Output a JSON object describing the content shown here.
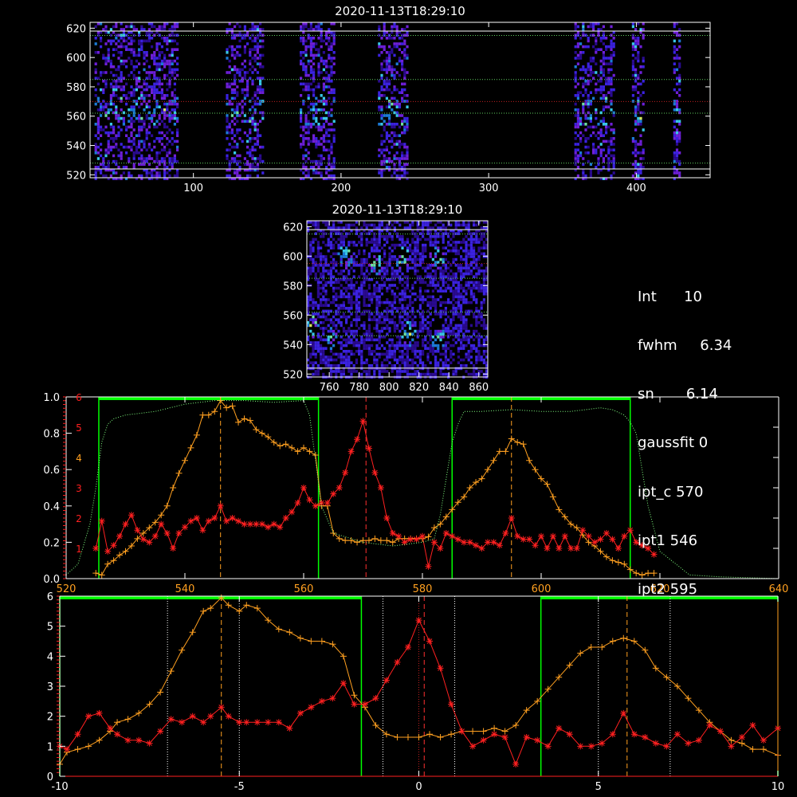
{
  "chart_data": [
    {
      "type": "heatmap",
      "title": "2020-11-13T18:29:10",
      "xticks": [
        100,
        200,
        300,
        400
      ],
      "yticks": [
        520,
        540,
        560,
        580,
        600,
        620
      ],
      "xlim": [
        30,
        450
      ],
      "ylim": [
        518,
        624
      ],
      "hlines": {
        "white": [
          524,
          618
        ],
        "green_dotted": [
          528,
          562,
          585,
          615
        ],
        "red_dotted": [
          570
        ]
      },
      "bands": [
        [
          33,
          90
        ],
        [
          122,
          147
        ],
        [
          172,
          195
        ],
        [
          225,
          245
        ],
        [
          358,
          385
        ],
        [
          397,
          405
        ],
        [
          425,
          429
        ]
      ],
      "colormap": [
        "#000000",
        "#2a0a8f",
        "#3b22e0",
        "#6e1fd8",
        "#1c7ad6",
        "#38c6e6",
        "#6ee0a0",
        "#d4e860"
      ]
    },
    {
      "type": "heatmap",
      "title": "2020-11-13T18:29:10",
      "xticks": [
        760,
        780,
        800,
        820,
        840,
        860
      ],
      "yticks": [
        520,
        540,
        560,
        580,
        600,
        620
      ],
      "xlim": [
        745,
        866
      ],
      "ylim": [
        518,
        624
      ],
      "hlines": {
        "white": [
          524,
          618
        ],
        "green_dotted": [
          546,
          562,
          585,
          615
        ],
        "red_dotted": [
          595
        ]
      },
      "hot_spots": [
        [
          831,
          600
        ],
        [
          832,
          545
        ],
        [
          812,
          548
        ],
        [
          808,
          600
        ],
        [
          760,
          545
        ],
        [
          748,
          553
        ],
        [
          770,
          600
        ],
        [
          790,
          595
        ]
      ]
    },
    {
      "type": "line",
      "xticks": [
        520,
        540,
        560,
        580,
        600,
        620,
        640
      ],
      "yticks_left": [
        0.0,
        0.2,
        0.4,
        0.6,
        0.8,
        1.0
      ],
      "ytick_labels_left": [
        "0.0",
        "0.2",
        "0.4",
        "0.6",
        "0.8",
        "1.0"
      ],
      "yticks_right": [
        1,
        2,
        3,
        4,
        5,
        6
      ],
      "xlim": [
        520,
        640
      ],
      "ylim": [
        0,
        1.0
      ],
      "ylim_right": [
        0,
        6
      ],
      "green_windows": [
        [
          525.5,
          562.5
        ],
        [
          585,
          615
        ]
      ],
      "orange_dashed_x": [
        546,
        595
      ],
      "red_dashed_x": [
        570.5
      ],
      "series": [
        {
          "color": "#ffa020",
          "marker": "+",
          "axis": "left",
          "x": [
            525,
            526,
            527,
            528,
            529,
            530,
            531,
            532,
            533,
            534,
            535,
            536,
            537,
            538,
            539,
            540,
            541,
            542,
            543,
            544,
            545,
            546,
            547,
            548,
            549,
            550,
            551,
            552,
            553,
            554,
            555,
            556,
            557,
            558,
            559,
            560,
            561,
            562,
            563,
            564,
            565,
            566,
            567,
            568,
            569,
            570,
            571,
            572,
            573,
            574,
            575,
            576,
            577,
            578,
            579,
            580,
            581,
            582,
            583,
            584,
            585,
            586,
            587,
            588,
            589,
            590,
            591,
            592,
            593,
            594,
            595,
            596,
            597,
            598,
            599,
            600,
            601,
            602,
            603,
            604,
            605,
            606,
            607,
            608,
            609,
            610,
            611,
            612,
            613,
            614,
            615,
            616,
            617,
            618,
            619
          ],
          "y": [
            0.03,
            0.02,
            0.08,
            0.1,
            0.13,
            0.15,
            0.18,
            0.22,
            0.25,
            0.28,
            0.31,
            0.35,
            0.4,
            0.5,
            0.58,
            0.65,
            0.72,
            0.79,
            0.9,
            0.9,
            0.92,
            0.98,
            0.94,
            0.95,
            0.86,
            0.88,
            0.87,
            0.82,
            0.8,
            0.78,
            0.75,
            0.73,
            0.74,
            0.72,
            0.7,
            0.72,
            0.7,
            0.68,
            0.4,
            0.4,
            0.25,
            0.22,
            0.21,
            0.21,
            0.2,
            0.21,
            0.21,
            0.22,
            0.21,
            0.21,
            0.2,
            0.22,
            0.22,
            0.22,
            0.22,
            0.22,
            0.23,
            0.28,
            0.3,
            0.34,
            0.38,
            0.42,
            0.45,
            0.5,
            0.53,
            0.55,
            0.6,
            0.65,
            0.7,
            0.7,
            0.77,
            0.75,
            0.74,
            0.65,
            0.6,
            0.55,
            0.52,
            0.45,
            0.38,
            0.34,
            0.3,
            0.28,
            0.24,
            0.2,
            0.18,
            0.15,
            0.12,
            0.1,
            0.09,
            0.08,
            0.05,
            0.03,
            0.02,
            0.03,
            0.03
          ]
        },
        {
          "color": "#ff2020",
          "marker": "*",
          "axis": "right",
          "x": [
            525,
            526,
            527,
            528,
            529,
            530,
            531,
            532,
            533,
            534,
            535,
            536,
            537,
            538,
            539,
            540,
            541,
            542,
            543,
            544,
            545,
            546,
            547,
            548,
            549,
            550,
            551,
            552,
            553,
            554,
            555,
            556,
            557,
            558,
            559,
            560,
            561,
            562,
            563,
            564,
            565,
            566,
            567,
            568,
            569,
            570,
            571,
            572,
            573,
            574,
            575,
            576,
            577,
            578,
            579,
            580,
            581,
            582,
            583,
            584,
            585,
            586,
            587,
            588,
            589,
            590,
            591,
            592,
            593,
            594,
            595,
            596,
            597,
            598,
            599,
            600,
            601,
            602,
            603,
            604,
            605,
            606,
            607,
            608,
            609,
            610,
            611,
            612,
            613,
            614,
            615,
            616,
            617,
            618,
            619
          ],
          "y": [
            1.0,
            1.9,
            0.9,
            1.1,
            1.4,
            1.8,
            2.1,
            1.6,
            1.3,
            1.2,
            1.4,
            1.8,
            1.5,
            1.0,
            1.5,
            1.7,
            1.9,
            2.0,
            1.6,
            1.9,
            2.0,
            2.4,
            1.9,
            2.0,
            1.9,
            1.8,
            1.8,
            1.8,
            1.8,
            1.7,
            1.8,
            1.7,
            2.0,
            2.2,
            2.5,
            3.0,
            2.6,
            2.4,
            2.5,
            2.5,
            2.8,
            3.0,
            3.5,
            4.2,
            4.6,
            5.2,
            4.3,
            3.5,
            3.0,
            2.0,
            1.5,
            1.4,
            1.2,
            1.3,
            1.3,
            1.4,
            0.4,
            1.2,
            1.0,
            1.5,
            1.4,
            1.3,
            1.2,
            1.2,
            1.1,
            1.0,
            1.2,
            1.2,
            1.1,
            1.5,
            2.0,
            1.4,
            1.3,
            1.3,
            1.1,
            1.4,
            1.0,
            1.4,
            1.0,
            1.4,
            1.0,
            1.0,
            1.6,
            1.4,
            1.2,
            1.3,
            1.5,
            1.3,
            1.0,
            1.4,
            1.6,
            1.2,
            1.1,
            1.0,
            0.8
          ]
        },
        {
          "color": "#80ff80",
          "style": "dotted",
          "axis": "left",
          "x": [
            520,
            522,
            524,
            525,
            526,
            527,
            528,
            530,
            535,
            540,
            545,
            550,
            555,
            560,
            561,
            562,
            563,
            565,
            570,
            575,
            580,
            582,
            583,
            584,
            585,
            586,
            587,
            590,
            595,
            600,
            605,
            610,
            612,
            614,
            615,
            616,
            617,
            618,
            620,
            625,
            630,
            640
          ],
          "y": [
            0.02,
            0.08,
            0.3,
            0.5,
            0.75,
            0.85,
            0.88,
            0.9,
            0.92,
            0.96,
            0.98,
            0.98,
            0.97,
            0.98,
            0.9,
            0.65,
            0.4,
            0.25,
            0.2,
            0.18,
            0.2,
            0.22,
            0.35,
            0.55,
            0.75,
            0.85,
            0.92,
            0.92,
            0.93,
            0.92,
            0.92,
            0.94,
            0.93,
            0.9,
            0.86,
            0.8,
            0.6,
            0.4,
            0.15,
            0.02,
            0.01,
            0.0
          ]
        }
      ]
    },
    {
      "type": "line",
      "xticks": [
        -10,
        -5,
        0,
        5,
        10
      ],
      "yticks_left": [
        0,
        1,
        2,
        3,
        4,
        5,
        6
      ],
      "xlim": [
        -10,
        10
      ],
      "ylim": [
        0,
        6
      ],
      "green_windows": [
        [
          -10,
          -1.6
        ],
        [
          3.4,
          10
        ]
      ],
      "white_dotted_x": [
        -7,
        -5,
        -1,
        1,
        5,
        7
      ],
      "orange_dashed_x": [
        -5.5,
        5.8
      ],
      "red_dashed_x": [
        0.15
      ],
      "series": [
        {
          "color": "#ffa020",
          "marker": "+",
          "axis": "left",
          "x": [
            -10,
            -9.8,
            -9.5,
            -9.2,
            -8.9,
            -8.6,
            -8.4,
            -8.1,
            -7.8,
            -7.5,
            -7.2,
            -6.9,
            -6.6,
            -6.3,
            -6.0,
            -5.8,
            -5.5,
            -5.3,
            -5.0,
            -4.8,
            -4.5,
            -4.2,
            -3.9,
            -3.6,
            -3.3,
            -3.0,
            -2.7,
            -2.4,
            -2.1,
            -1.8,
            -1.5,
            -1.2,
            -0.9,
            -0.6,
            -0.3,
            0.0,
            0.3,
            0.6,
            0.9,
            1.2,
            1.5,
            1.8,
            2.1,
            2.4,
            2.7,
            3.0,
            3.3,
            3.6,
            3.9,
            4.2,
            4.5,
            4.8,
            5.1,
            5.4,
            5.7,
            6.0,
            6.3,
            6.6,
            6.9,
            7.2,
            7.5,
            7.8,
            8.1,
            8.4,
            8.7,
            9.0,
            9.3,
            9.6,
            10.0
          ],
          "y": [
            0.4,
            0.8,
            0.9,
            1.0,
            1.2,
            1.5,
            1.8,
            1.9,
            2.1,
            2.4,
            2.8,
            3.5,
            4.2,
            4.8,
            5.5,
            5.6,
            5.95,
            5.7,
            5.5,
            5.7,
            5.6,
            5.2,
            4.9,
            4.8,
            4.6,
            4.5,
            4.5,
            4.4,
            4.0,
            2.7,
            2.3,
            1.7,
            1.4,
            1.3,
            1.3,
            1.3,
            1.4,
            1.3,
            1.4,
            1.5,
            1.5,
            1.5,
            1.6,
            1.5,
            1.7,
            2.2,
            2.5,
            2.9,
            3.3,
            3.7,
            4.1,
            4.3,
            4.3,
            4.5,
            4.6,
            4.5,
            4.2,
            3.6,
            3.3,
            3.0,
            2.6,
            2.2,
            1.8,
            1.5,
            1.2,
            1.1,
            0.9,
            0.9,
            0.7
          ]
        },
        {
          "color": "#ff2020",
          "marker": "*",
          "axis": "left",
          "x": [
            -10,
            -9.8,
            -9.5,
            -9.2,
            -8.9,
            -8.6,
            -8.4,
            -8.1,
            -7.8,
            -7.5,
            -7.2,
            -6.9,
            -6.6,
            -6.3,
            -6.0,
            -5.8,
            -5.5,
            -5.3,
            -5.0,
            -4.8,
            -4.5,
            -4.2,
            -3.9,
            -3.6,
            -3.3,
            -3.0,
            -2.7,
            -2.4,
            -2.1,
            -1.8,
            -1.5,
            -1.2,
            -0.9,
            -0.6,
            -0.3,
            0.0,
            0.3,
            0.6,
            0.9,
            1.2,
            1.5,
            1.8,
            2.1,
            2.4,
            2.7,
            3.0,
            3.3,
            3.6,
            3.9,
            4.2,
            4.5,
            4.8,
            5.1,
            5.4,
            5.7,
            6.0,
            6.3,
            6.6,
            6.9,
            7.2,
            7.5,
            7.8,
            8.1,
            8.4,
            8.7,
            9.0,
            9.3,
            9.6,
            10.0
          ],
          "y": [
            1.0,
            0.9,
            1.4,
            2.0,
            2.1,
            1.6,
            1.4,
            1.2,
            1.2,
            1.1,
            1.5,
            1.9,
            1.8,
            2.0,
            1.8,
            2.0,
            2.3,
            2.0,
            1.8,
            1.8,
            1.8,
            1.8,
            1.8,
            1.6,
            2.1,
            2.3,
            2.5,
            2.6,
            3.1,
            2.4,
            2.4,
            2.6,
            3.2,
            3.8,
            4.3,
            5.2,
            4.5,
            3.6,
            2.4,
            1.5,
            1.0,
            1.2,
            1.4,
            1.3,
            0.4,
            1.3,
            1.2,
            1.0,
            1.6,
            1.4,
            1.0,
            1.0,
            1.1,
            1.4,
            2.1,
            1.4,
            1.3,
            1.1,
            1.0,
            1.4,
            1.1,
            1.2,
            1.7,
            1.5,
            1.0,
            1.3,
            1.7,
            1.2,
            1.6
          ]
        }
      ]
    }
  ],
  "params": {
    "int_line": "Int      10",
    "fwhm_line": "fwhm     6.34",
    "sn_line": "sn       6.14",
    "gaussfit_line": "gaussfit 0",
    "ipt_c_line": "ipt_c 570",
    "ipt1_line": "ipt1 546",
    "ipt2_line": "ipt2 595"
  },
  "colors": {
    "axis": "#ffffff",
    "orange": "#ffa020",
    "red": "#ff2020",
    "green": "#00ff00",
    "light_green": "#80ff80"
  }
}
